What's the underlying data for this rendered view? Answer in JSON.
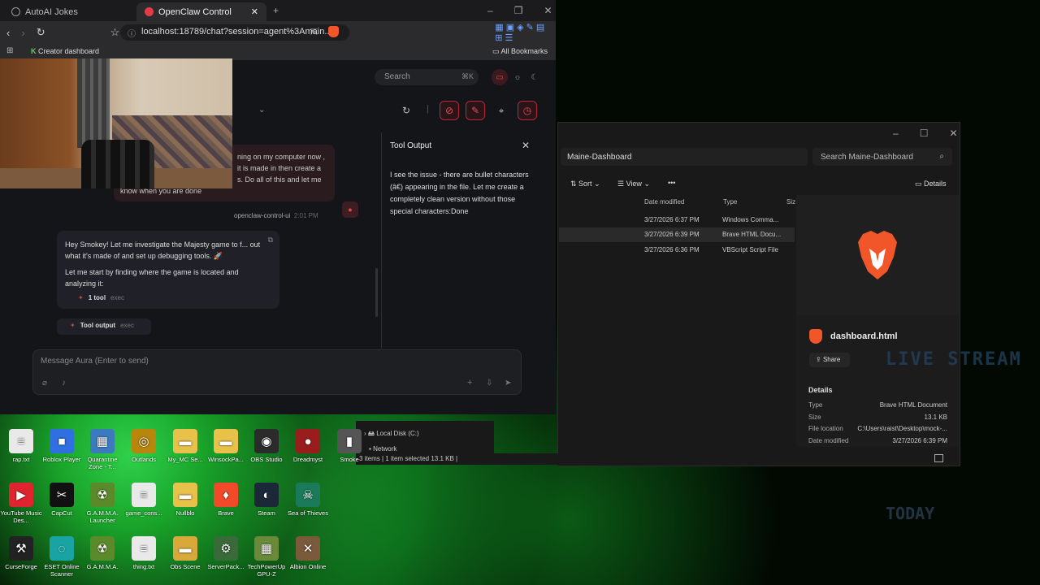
{
  "browser": {
    "tabs": [
      {
        "label": "AutoAI Jokes"
      },
      {
        "label": "OpenClaw Control"
      }
    ],
    "new_tab": "+",
    "url": "localhost:18789/chat?session=agent%3Amain...",
    "bookmarks": {
      "left": "Creator dashboard",
      "right": "All Bookmarks"
    }
  },
  "app": {
    "search_placeholder": "Search",
    "search_shortcut": "⌘K",
    "chat": {
      "user_message_lines": [
        "ning on my computer now ,",
        "it is made in then create a",
        "s. Do all of this and let me",
        "know when you are done"
      ],
      "sender": "openclaw-control-ui",
      "sender_time": "2:01 PM",
      "assistant_paragraph1": "Hey Smokey! Let me investigate the Majesty game to f... out what it's made of and set up debugging tools. 🚀",
      "assistant_paragraph2": "Let me start by finding where the game is located and analyzing it:",
      "tool_line": {
        "label": "1 tool",
        "meta": "exec"
      },
      "tool_output_line": {
        "label": "Tool output",
        "meta": "exec"
      }
    },
    "panel": {
      "title": "Tool Output",
      "body": "I see the issue - there are bullet characters (â€) appearing in the file. Let me create a completely clean version without those special characters:Done"
    },
    "composer_placeholder": "Message Aura (Enter to send)"
  },
  "explorer": {
    "address": "Maine-Dashboard",
    "search_placeholder": "Search Maine-Dashboard",
    "commands": {
      "sort": "Sort",
      "view": "View",
      "more": "•••",
      "details": "Details"
    },
    "columns": {
      "date": "Date modified",
      "type": "Type",
      "size": "Siz"
    },
    "rows": [
      {
        "date": "3/27/2026 6:37 PM",
        "type": "Windows Comma..."
      },
      {
        "date": "3/27/2026 6:39 PM",
        "type": "Brave HTML Docu..."
      },
      {
        "date": "3/27/2026 6:36 PM",
        "type": "VBScript Script File"
      }
    ],
    "details_pane": {
      "filename": "dashboard.html",
      "share": "Share",
      "heading": "Details",
      "fields": [
        {
          "label": "Type",
          "value": "Brave HTML Document"
        },
        {
          "label": "Size",
          "value": "13.1 KB"
        },
        {
          "label": "File location",
          "value": "C:\\Users\\raist\\Desktop\\mock-..."
        },
        {
          "label": "Date modified",
          "value": "3/27/2026 6:39 PM"
        }
      ]
    },
    "nav": {
      "local_disk": "Local Disk (C:)",
      "network": "Network"
    },
    "status": "3 items  |  1 item selected  13.1 KB  |"
  },
  "desktop": {
    "icons": [
      {
        "label": "rap.txt",
        "glyph": "≡",
        "color": "#e9e9e9"
      },
      {
        "label": "Roblox Player",
        "glyph": "■",
        "color": "#2f6fe0"
      },
      {
        "label": "Quarantine Zone - T...",
        "glyph": "▦",
        "color": "#3b7bbd"
      },
      {
        "label": "Outlands",
        "glyph": "◎",
        "color": "#b8860b"
      },
      {
        "label": "My_MC Se...",
        "glyph": "▬",
        "color": "#e8c14a"
      },
      {
        "label": "WinsockPa...",
        "glyph": "▬",
        "color": "#e8c14a"
      },
      {
        "label": "OBS Studio",
        "glyph": "◉",
        "color": "#2b2b2b"
      },
      {
        "label": "Dreadmyst",
        "glyph": "●",
        "color": "#9a1d1d"
      },
      {
        "label": "Smoke",
        "glyph": "▮",
        "color": "#555"
      },
      {
        "label": "YouTube Music Des...",
        "glyph": "▶",
        "color": "#e0242f"
      },
      {
        "label": "CapCut",
        "glyph": "✂",
        "color": "#111"
      },
      {
        "label": "G.A.M.M.A. Launcher",
        "glyph": "☢",
        "color": "#5a8a2a"
      },
      {
        "label": "game_cons...",
        "glyph": "≡",
        "color": "#e9e9e9"
      },
      {
        "label": "Nullblo",
        "glyph": "▬",
        "color": "#e8c14a"
      },
      {
        "label": "Brave",
        "glyph": "♦",
        "color": "#f04a2b"
      },
      {
        "label": "Steam",
        "glyph": "◐",
        "color": "#1b2838"
      },
      {
        "label": "Sea of Thieves",
        "glyph": "☠",
        "color": "#1a7a5a"
      },
      {
        "label": "CurseForge",
        "glyph": "⚒",
        "color": "#222"
      },
      {
        "label": "ESET Online Scanner",
        "glyph": "◌",
        "color": "#1aa3a3"
      },
      {
        "label": "G.A.M.M.A.",
        "glyph": "☢",
        "color": "#5a8a2a"
      },
      {
        "label": "thing.txt",
        "glyph": "≡",
        "color": "#e9e9e9"
      },
      {
        "label": "Obs Scene",
        "glyph": "▬",
        "color": "#d8a93a"
      },
      {
        "label": "ServerPack...",
        "glyph": "⚙",
        "color": "#3a6a3a"
      },
      {
        "label": "TechPowerUp GPU-Z",
        "glyph": "▦",
        "color": "#6a8a3a"
      },
      {
        "label": "Albion Online",
        "glyph": "✕",
        "color": "#7a5a3a"
      }
    ]
  },
  "wallpaper": {
    "text1": "LIVE STREAM",
    "text2": "TODAY"
  }
}
